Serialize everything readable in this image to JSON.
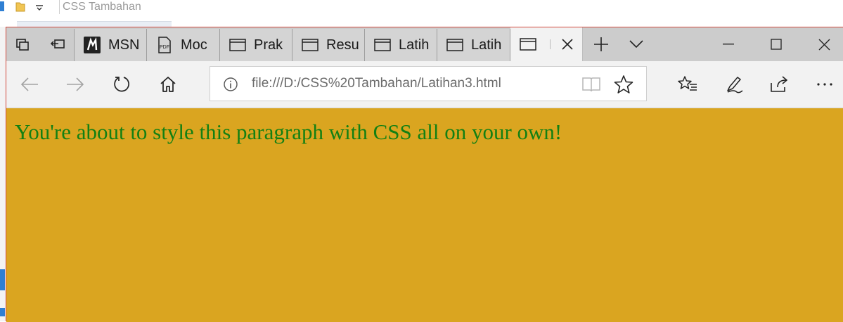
{
  "explorer": {
    "title": "CSS Tambahan"
  },
  "browser": {
    "tabs": [
      {
        "label": "MSN",
        "icon": "msn-icon"
      },
      {
        "label": "Moc",
        "icon": "pdf-icon"
      },
      {
        "label": "Prak",
        "icon": "page-icon"
      },
      {
        "label": "Resu",
        "icon": "page-icon"
      },
      {
        "label": "Latih",
        "icon": "page-icon"
      },
      {
        "label": "Latih",
        "icon": "page-icon"
      },
      {
        "label": "",
        "icon": "page-icon",
        "active": true
      }
    ],
    "address": {
      "url": "file:///D:/CSS%20Tambahan/Latihan3.html"
    }
  },
  "page": {
    "background": "#daa520",
    "text_color": "#138013",
    "paragraph": "You're about to style this paragraph with CSS all on your own!"
  }
}
